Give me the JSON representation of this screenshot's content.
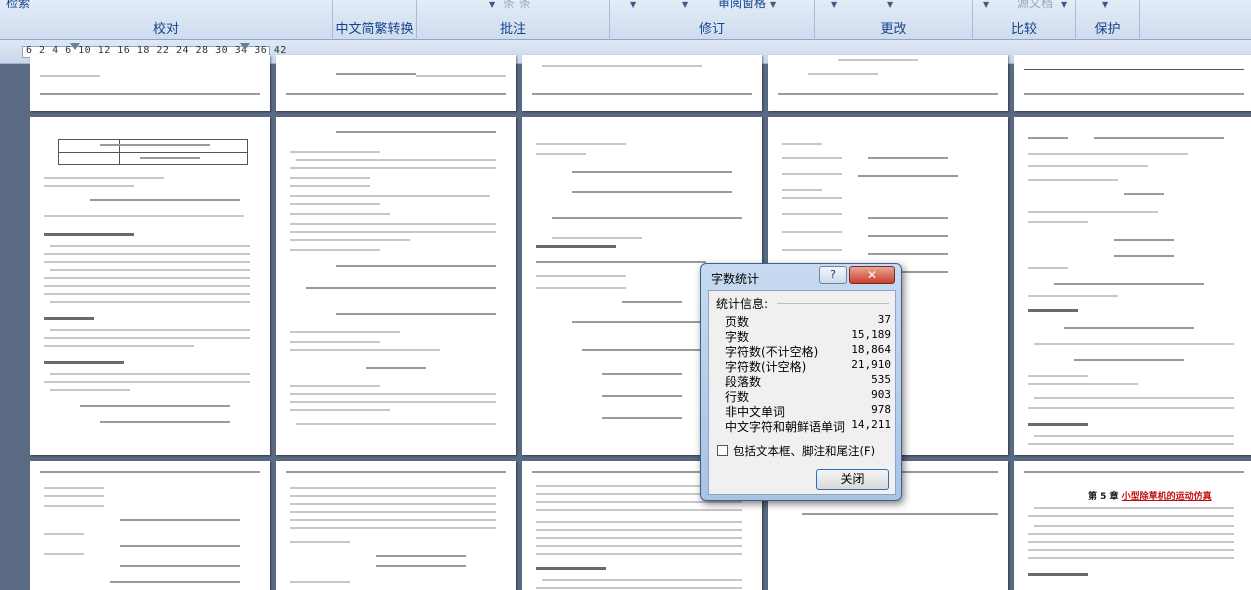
{
  "ribbon": {
    "groups": [
      {
        "label": "校对",
        "top": "检索"
      },
      {
        "label": "中文简繁转换",
        "top": ""
      },
      {
        "label": "批注",
        "top": "条  条"
      },
      {
        "label": "修订",
        "top": "审阅窗格"
      },
      {
        "label": "更改",
        "top": ""
      },
      {
        "label": "比较",
        "top": "源文档"
      },
      {
        "label": "保护",
        "top": ""
      }
    ]
  },
  "ruler": {
    "text": "6   2    4  6   10 12   16 18   22 24   28 30   34 36    42"
  },
  "pages": {
    "chapter_title_prefix": "第 5 章",
    "chapter_title_main": "小型除草机的运动仿真"
  },
  "dialog": {
    "title": "字数统计",
    "help": "?",
    "close_icon": "✕",
    "stats_header": "统计信息:",
    "stats": [
      {
        "label": "页数",
        "value": "37"
      },
      {
        "label": "字数",
        "value": "15,189"
      },
      {
        "label": "字符数(不计空格)",
        "value": "18,864"
      },
      {
        "label": "字符数(计空格)",
        "value": "21,910"
      },
      {
        "label": "段落数",
        "value": "535"
      },
      {
        "label": "行数",
        "value": "903"
      },
      {
        "label": "非中文单词",
        "value": "978"
      },
      {
        "label": "中文字符和朝鲜语单词",
        "value": "14,211"
      }
    ],
    "checkbox_label": "包括文本框、脚注和尾注(F)",
    "close_button": "关闭"
  }
}
